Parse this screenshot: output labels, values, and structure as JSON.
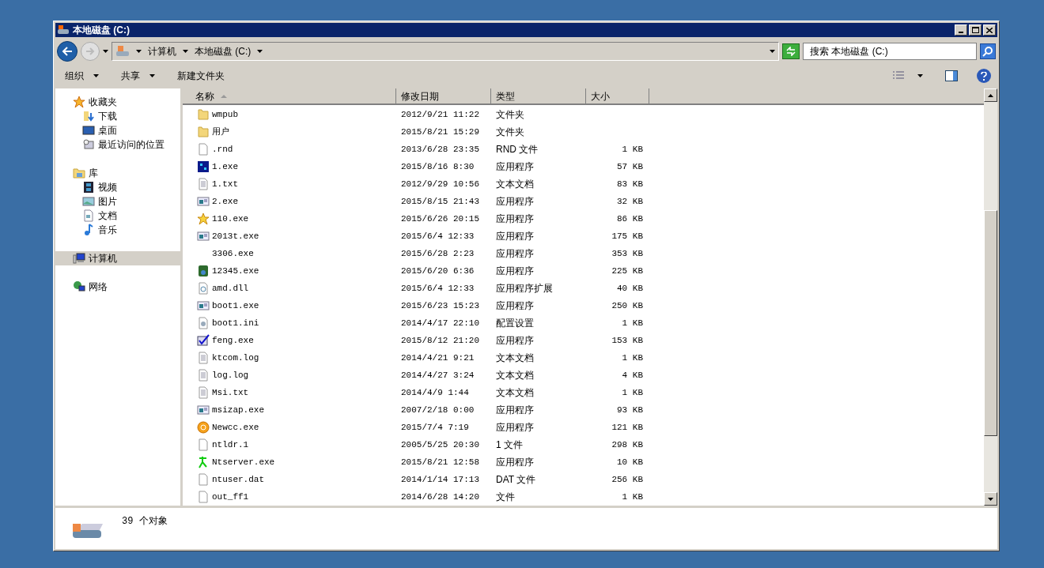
{
  "window": {
    "title": "本地磁盘 (C:)"
  },
  "address_bar": {
    "path": [
      {
        "label": "计算机"
      },
      {
        "label": "本地磁盘 (C:)"
      }
    ]
  },
  "search": {
    "placeholder": "搜索 本地磁盘 (C:)"
  },
  "toolbar": {
    "buttons": [
      {
        "label": "组织",
        "dropdown": true
      },
      {
        "label": "共享",
        "dropdown": true
      },
      {
        "label": "新建文件夹",
        "dropdown": false
      }
    ]
  },
  "sidebar": {
    "items": [
      {
        "label": "收藏夹",
        "kind": "star",
        "selected": false,
        "children": [
          {
            "label": "下载",
            "kind": "download",
            "selected": false
          },
          {
            "label": "桌面",
            "kind": "desktop",
            "selected": false
          },
          {
            "label": "最近访问的位置",
            "kind": "recent",
            "selected": false
          }
        ]
      },
      {
        "label": "库",
        "kind": "library",
        "selected": false,
        "children": [
          {
            "label": "视频",
            "kind": "video",
            "selected": false
          },
          {
            "label": "图片",
            "kind": "picture",
            "selected": false
          },
          {
            "label": "文档",
            "kind": "document",
            "selected": false
          },
          {
            "label": "音乐",
            "kind": "music",
            "selected": false
          }
        ]
      },
      {
        "label": "计算机",
        "kind": "computer",
        "selected": true
      },
      {
        "label": "网络",
        "kind": "network",
        "selected": false
      }
    ]
  },
  "table": {
    "columns": [
      {
        "label": "名称",
        "sorted": true
      },
      {
        "label": "修改日期",
        "sorted": false
      },
      {
        "label": "类型",
        "sorted": false
      },
      {
        "label": "大小",
        "sorted": false
      }
    ],
    "rows": [
      {
        "kind": "folder",
        "name": "wmpub",
        "date": "2012/9/21 11:22",
        "type": "文件夹"
      },
      {
        "kind": "folder",
        "name": "用户",
        "date": "2015/8/21 15:29",
        "type": "文件夹"
      },
      {
        "kind": "blank",
        "name": ".rnd",
        "date": "2013/6/28 23:35",
        "type": "RND 文件",
        "size": "1 KB"
      },
      {
        "kind": "dark-app",
        "name": "1.exe",
        "date": "2015/8/16 8:30",
        "type": "应用程序",
        "size": "57 KB"
      },
      {
        "kind": "text",
        "name": "1.txt",
        "date": "2012/9/29 10:56",
        "type": "文本文档",
        "size": "83 KB"
      },
      {
        "kind": "window",
        "name": "2.exe",
        "date": "2015/8/15 21:43",
        "type": "应用程序",
        "size": "32 KB"
      },
      {
        "kind": "star",
        "name": "110.exe",
        "date": "2015/6/26 20:15",
        "type": "应用程序",
        "size": "86 KB"
      },
      {
        "kind": "window",
        "name": "2013t.exe",
        "date": "2015/6/4 12:33",
        "type": "应用程序",
        "size": "175 KB"
      },
      {
        "kind": "none",
        "name": "3306.exe",
        "date": "2015/6/28 2:23",
        "type": "应用程序",
        "size": "353 KB"
      },
      {
        "kind": "green-app",
        "name": "12345.exe",
        "date": "2015/6/20 6:36",
        "type": "应用程序",
        "size": "225 KB"
      },
      {
        "kind": "dll",
        "name": "amd.dll",
        "date": "2015/6/4 12:33",
        "type": "应用程序扩展",
        "size": "40 KB"
      },
      {
        "kind": "window",
        "name": "boot1.exe",
        "date": "2015/6/23 15:23",
        "type": "应用程序",
        "size": "250 KB"
      },
      {
        "kind": "ini",
        "name": "boot1.ini",
        "date": "2014/4/17 22:10",
        "type": "配置设置",
        "size": "1 KB"
      },
      {
        "kind": "check",
        "name": "feng.exe",
        "date": "2015/8/12 21:20",
        "type": "应用程序",
        "size": "153 KB"
      },
      {
        "kind": "text",
        "name": "ktcom.log",
        "date": "2014/4/21 9:21",
        "type": "文本文档",
        "size": "1 KB"
      },
      {
        "kind": "text",
        "name": "log.log",
        "date": "2014/4/27 3:24",
        "type": "文本文档",
        "size": "4 KB"
      },
      {
        "kind": "text",
        "name": "Msi.txt",
        "date": "2014/4/9 1:44",
        "type": "文本文档",
        "size": "1 KB"
      },
      {
        "kind": "window",
        "name": "msizap.exe",
        "date": "2007/2/18 0:00",
        "type": "应用程序",
        "size": "93 KB"
      },
      {
        "kind": "orb",
        "name": "Newcc.exe",
        "date": "2015/7/4 7:19",
        "type": "应用程序",
        "size": "121 KB"
      },
      {
        "kind": "blank",
        "name": "ntldr.1",
        "date": "2005/5/25 20:30",
        "type": "1 文件",
        "size": "298 KB"
      },
      {
        "kind": "figure",
        "name": "Ntserver.exe",
        "date": "2015/8/21 12:58",
        "type": "应用程序",
        "size": "10 KB"
      },
      {
        "kind": "blank",
        "name": "ntuser.dat",
        "date": "2014/1/14 17:13",
        "type": "DAT 文件",
        "size": "256 KB"
      },
      {
        "kind": "blank",
        "name": "out_ff1",
        "date": "2014/6/28 14:20",
        "type": "文件",
        "size": "1 KB"
      }
    ]
  },
  "status_bar": {
    "count": "39 个对象"
  }
}
